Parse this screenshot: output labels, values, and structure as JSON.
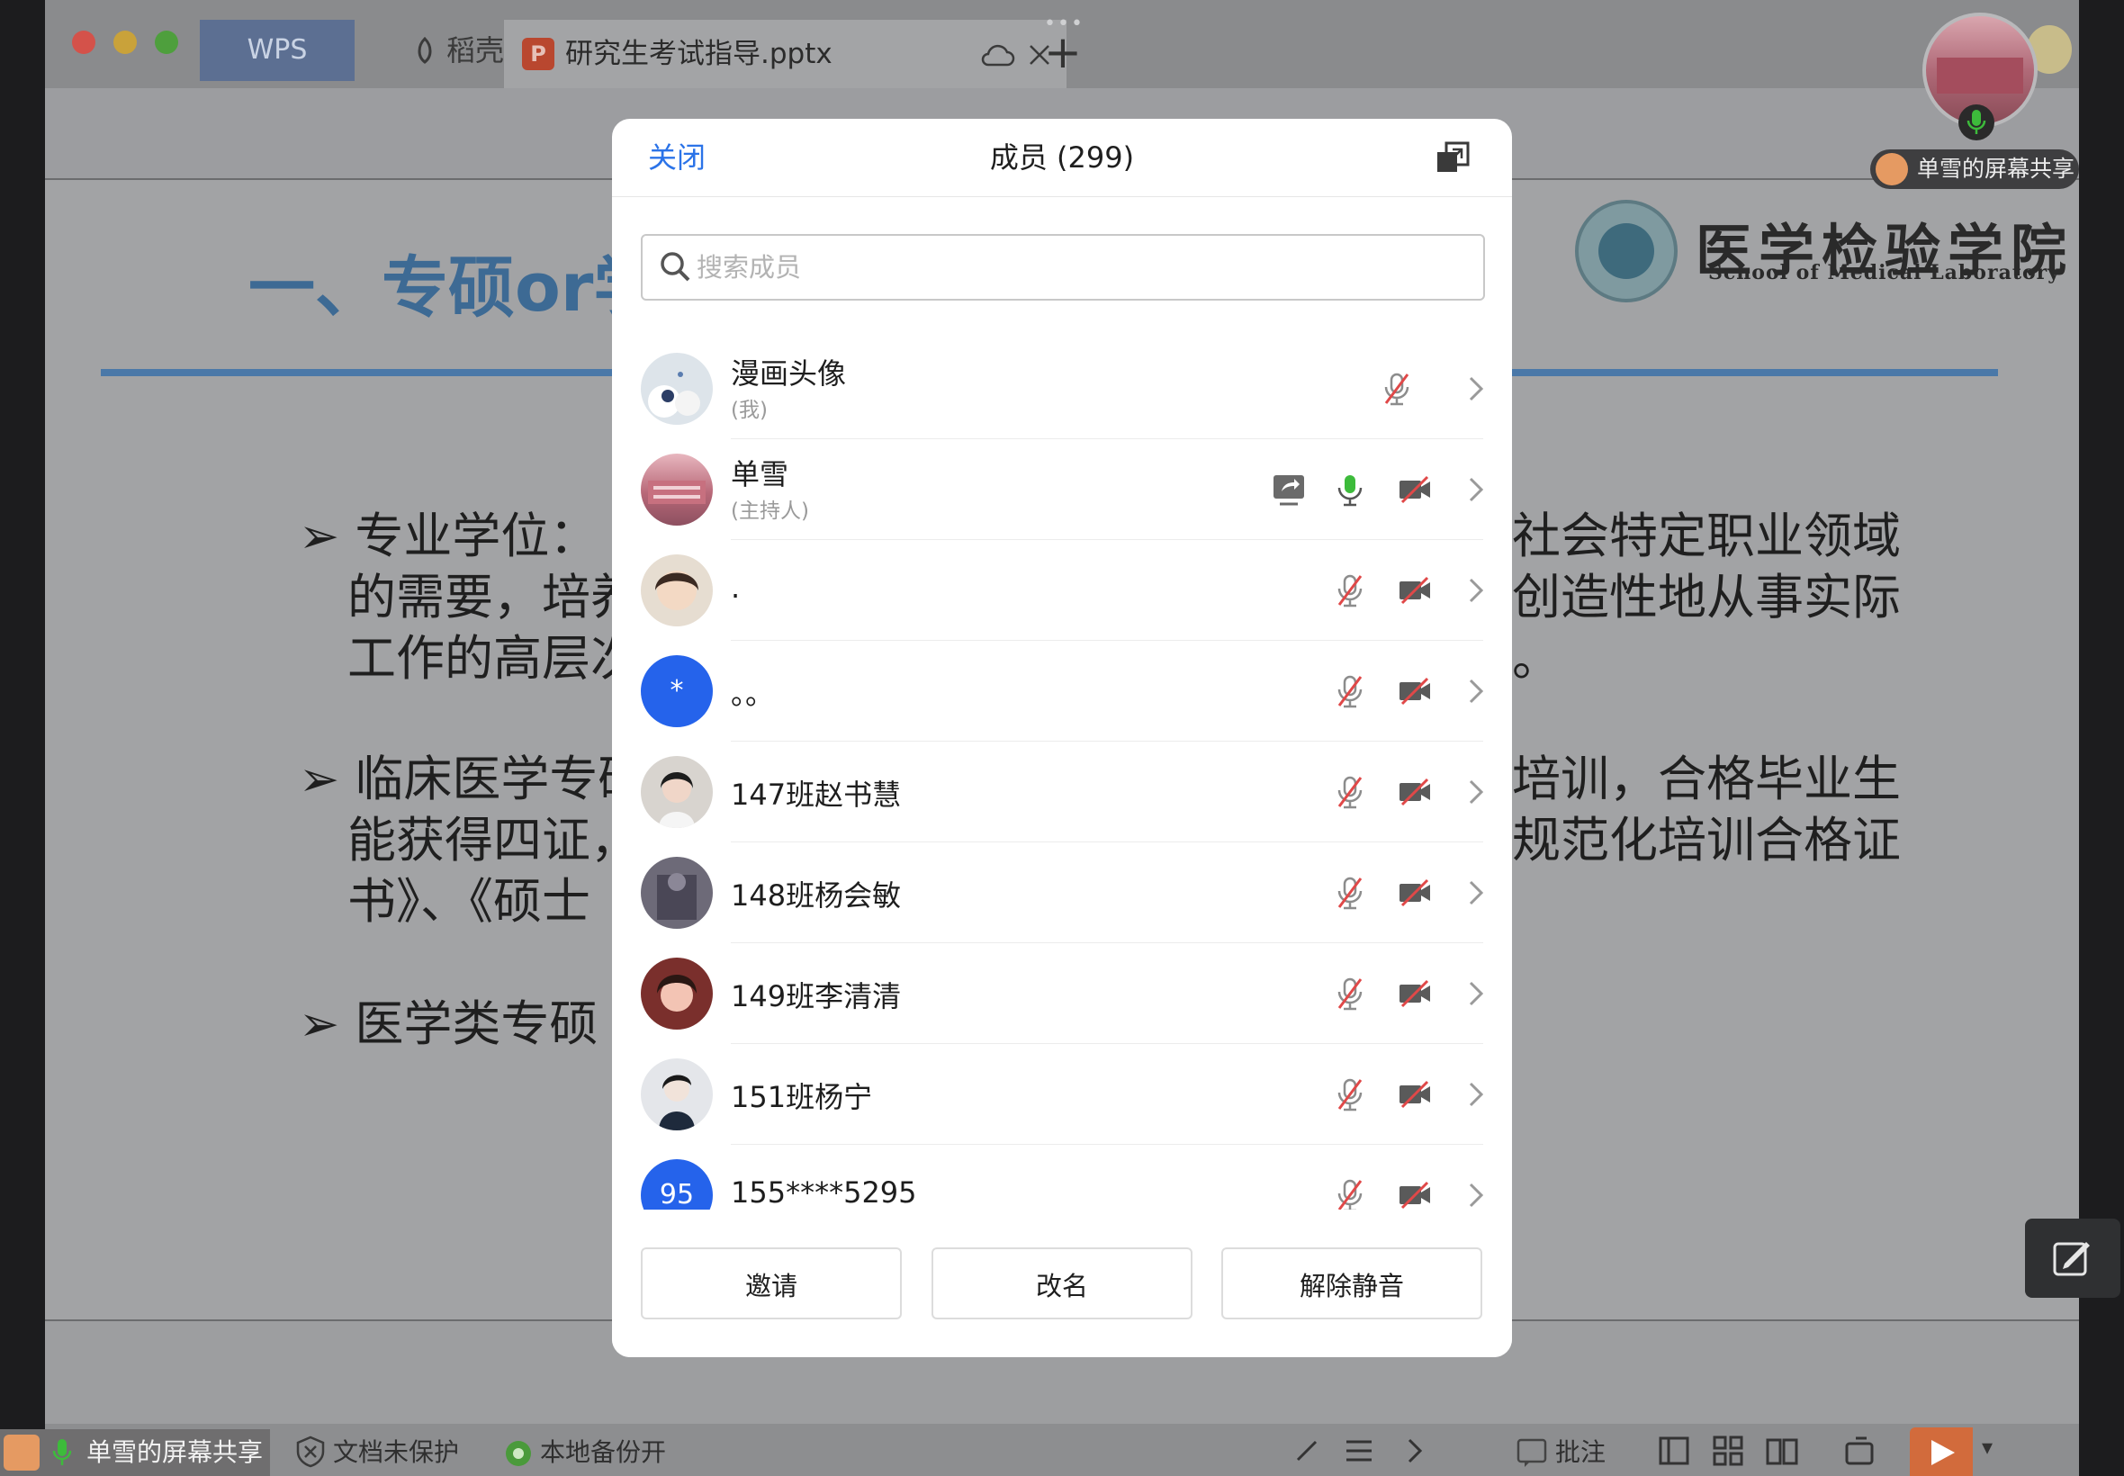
{
  "app": {
    "tabs": {
      "wps": "WPS",
      "daoke": "稻壳",
      "document": "研究生考试指导.pptx"
    }
  },
  "slide": {
    "title": "一、专硕or学",
    "logo_cn": "医学检验学院",
    "logo_en": "School of Medical Laboratory",
    "left_lines": [
      "➢ 专业学位：",
      "的需要，培养",
      "工作的高层次",
      "➢ 临床医学专硕",
      "能获得四证，",
      "书》、《硕士",
      "➢ 医学类专硕"
    ],
    "right_lines": [
      "社会特定职业领域",
      "创造性地从事实际",
      "。",
      "培训，合格毕业生",
      "规范化培训合格证"
    ]
  },
  "overlay": {
    "share_label_top": "单雪的屏幕共享",
    "share_label_bottom": "单雪的屏幕共享"
  },
  "statusbar": {
    "doc_protect": "文档未保护",
    "backup": "本地备份开",
    "annotate": "批注"
  },
  "members_panel": {
    "close": "关闭",
    "title": "成员 (299)",
    "search_placeholder": "搜索成员",
    "members": [
      {
        "name": "漫画头像",
        "role": "(我)"
      },
      {
        "name": "单雪",
        "role": "(主持人)"
      },
      {
        "name": "."
      },
      {
        "name": "。。",
        "avatar_text": "*"
      },
      {
        "name": "147班赵书慧"
      },
      {
        "name": "148班杨会敏"
      },
      {
        "name": "149班李清清"
      },
      {
        "name": "151班杨宁"
      },
      {
        "name": "155****5295",
        "avatar_text": "95"
      }
    ],
    "buttons": {
      "invite": "邀请",
      "rename": "改名",
      "unmute": "解除静音"
    }
  },
  "colors": {
    "accent": "#2b73e8",
    "mic_active": "#3dbb3b",
    "muted": "#d9534f",
    "avatar_blue": "#2563eb"
  }
}
